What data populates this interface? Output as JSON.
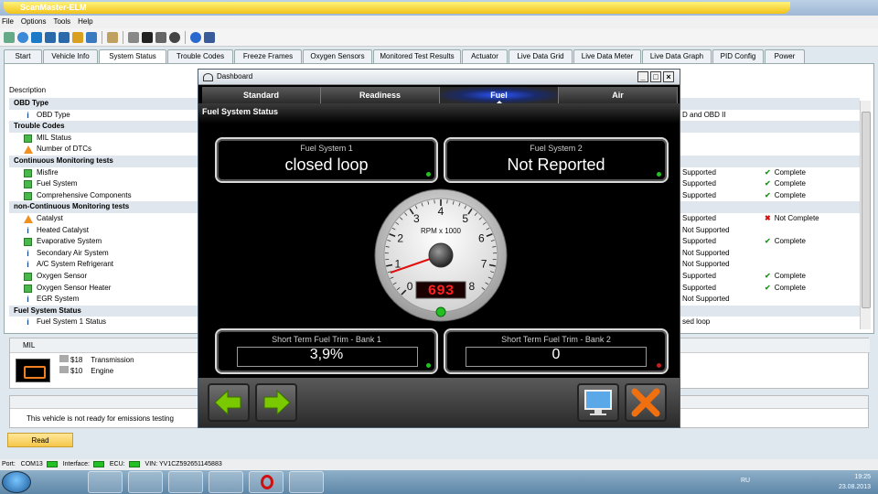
{
  "app": {
    "title": "ScanMaster-ELM"
  },
  "menu": [
    "File",
    "Options",
    "Tools",
    "Help"
  ],
  "tabs": [
    "Start",
    "Vehicle Info",
    "System Status",
    "Trouble Codes",
    "Freeze Frames",
    "Oxygen Sensors",
    "Monitored Test Results",
    "Actuator",
    "Live Data Grid",
    "Live Data Meter",
    "Live Data Graph",
    "PID Config",
    "Power"
  ],
  "active_tab": "System Status",
  "table": {
    "column_header": "Description",
    "rows": [
      {
        "kind": "group",
        "label": "OBD Type",
        "result": "",
        "status": ""
      },
      {
        "kind": "info",
        "label": "OBD Type",
        "result": "D and OBD II",
        "status": ""
      },
      {
        "kind": "group",
        "label": "Trouble Codes",
        "result": "",
        "status": ""
      },
      {
        "kind": "ok",
        "label": "MIL Status",
        "result": "",
        "status": ""
      },
      {
        "kind": "warn",
        "label": "Number of DTCs",
        "result": "",
        "status": ""
      },
      {
        "kind": "group",
        "label": "Continuous Monitoring tests",
        "result": "",
        "status": ""
      },
      {
        "kind": "ok",
        "label": "Misfire",
        "result": "Supported",
        "status": "Complete",
        "mark": "check"
      },
      {
        "kind": "ok",
        "label": "Fuel System",
        "result": "Supported",
        "status": "Complete",
        "mark": "check"
      },
      {
        "kind": "ok",
        "label": "Comprehensive Components",
        "result": "Supported",
        "status": "Complete",
        "mark": "check"
      },
      {
        "kind": "group",
        "label": "non-Continuous Monitoring tests",
        "result": "",
        "status": ""
      },
      {
        "kind": "warn",
        "label": "Catalyst",
        "result": "Supported",
        "status": "Not Complete",
        "mark": "cross"
      },
      {
        "kind": "info",
        "label": "Heated Catalyst",
        "result": "Not Supported",
        "status": ""
      },
      {
        "kind": "ok",
        "label": "Evaporative System",
        "result": "Supported",
        "status": "Complete",
        "mark": "check"
      },
      {
        "kind": "info",
        "label": "Secondary Air System",
        "result": "Not Supported",
        "status": ""
      },
      {
        "kind": "info",
        "label": "A/C System Refrigerant",
        "result": "Not Supported",
        "status": ""
      },
      {
        "kind": "ok",
        "label": "Oxygen Sensor",
        "result": "Supported",
        "status": "Complete",
        "mark": "check"
      },
      {
        "kind": "ok",
        "label": "Oxygen Sensor Heater",
        "result": "Supported",
        "status": "Complete",
        "mark": "check"
      },
      {
        "kind": "info",
        "label": "EGR System",
        "result": "Not Supported",
        "status": ""
      },
      {
        "kind": "group",
        "label": "Fuel System Status",
        "result": "",
        "status": ""
      },
      {
        "kind": "info",
        "label": "Fuel System 1 Status",
        "result": "sed loop",
        "status": ""
      }
    ]
  },
  "mil": {
    "label": "MIL",
    "dtcs": [
      {
        "code": "$18",
        "module": "Transmission"
      },
      {
        "code": "$10",
        "module": "Engine"
      }
    ]
  },
  "readiness_message": "This vehicle is not ready for emissions testing",
  "read_button": "Read",
  "statusbar": {
    "port_label": "Port:",
    "port": "COM13",
    "interface_label": "Interface:",
    "ecu_label": "ECU:",
    "vin": "VIN: YV1CZ592651145883"
  },
  "taskbar": {
    "language": "RU",
    "time": "19:25",
    "date": "23.08.2013"
  },
  "dashboard": {
    "title": "Dashboard",
    "tabs": [
      "Standard",
      "Readiness",
      "Fuel",
      "Air"
    ],
    "active_tab": "Fuel",
    "section": "Fuel System Status",
    "fuel_system_1": {
      "caption": "Fuel System 1",
      "value": "closed loop"
    },
    "fuel_system_2": {
      "caption": "Fuel System 2",
      "value": "Not Reported"
    },
    "tachometer": {
      "unit": "RPM x 1000",
      "ticks": [
        "0",
        "1",
        "2",
        "3",
        "4",
        "5",
        "6",
        "7",
        "8"
      ],
      "rpm": "693"
    },
    "trim_bank1": {
      "caption": "Short Term Fuel Trim - Bank 1",
      "value": "3,9%"
    },
    "trim_bank2": {
      "caption": "Short Term Fuel Trim - Bank 2",
      "value": "0"
    }
  },
  "colors": {
    "ok_led": "#22c022",
    "off_led": "#c02020",
    "tab_highlight": "#2a55ff",
    "read_button": "#f5c74a"
  }
}
